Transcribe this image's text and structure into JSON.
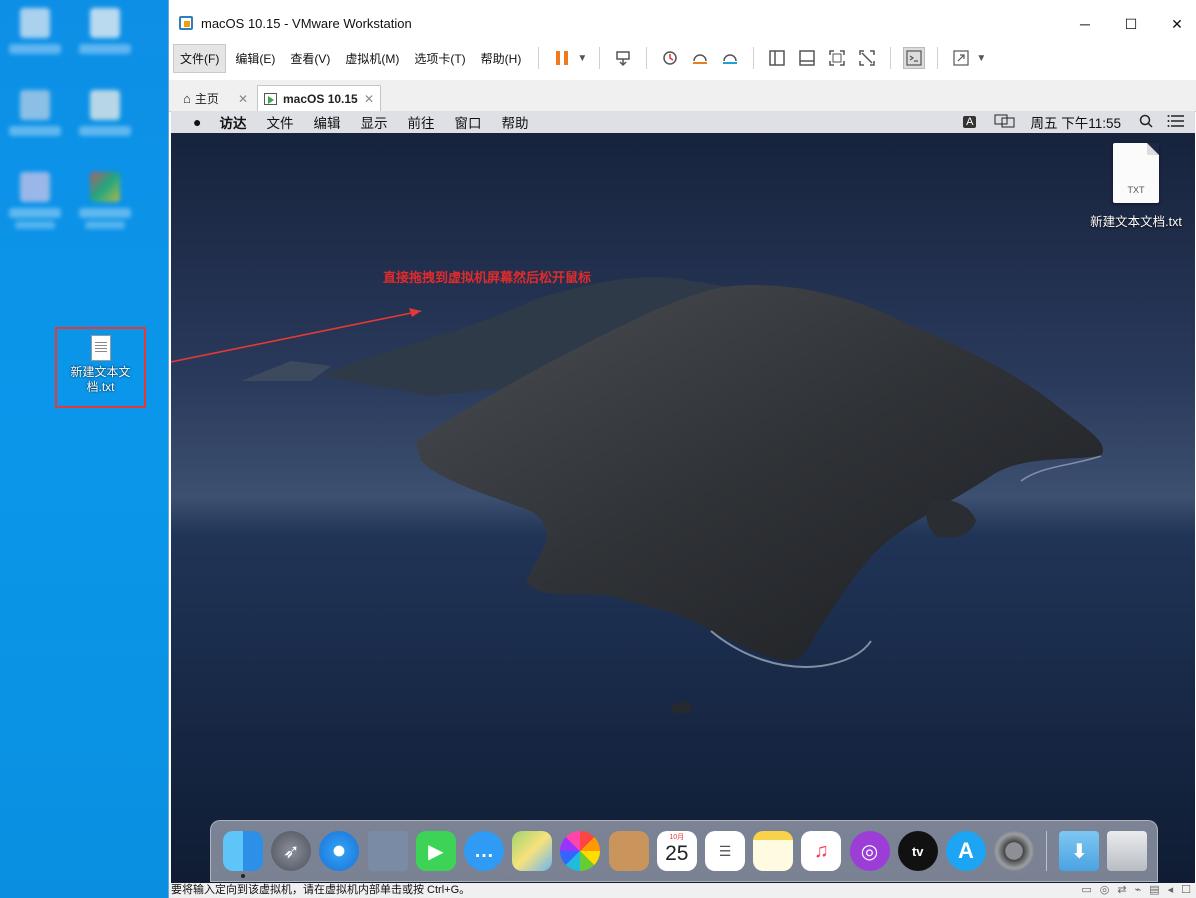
{
  "desktop": {
    "file": {
      "name": "新建文本文档.txt"
    }
  },
  "window": {
    "title": "macOS 10.15 - VMware Workstation",
    "minimize": "─",
    "maximize": "☐",
    "close": "✕"
  },
  "menu": [
    "文件(F)",
    "编辑(E)",
    "查看(V)",
    "虚拟机(M)",
    "选项卡(T)",
    "帮助(H)"
  ],
  "tabs": [
    {
      "label": "主页",
      "close": "✕"
    },
    {
      "label": "macOS 10.15",
      "close": "✕"
    }
  ],
  "mac": {
    "menubar": [
      "访达",
      "文件",
      "编辑",
      "显示",
      "前往",
      "窗口",
      "帮助"
    ],
    "input_indicator": "A",
    "clock": "周五 下午11:55",
    "desktop_file": {
      "name": "新建文本文档.txt",
      "badge": "TXT"
    },
    "annotation": "直接拖拽到虚拟机屏幕然后松开鼠标",
    "calendar": {
      "month": "10月",
      "day": "25"
    },
    "tv_label": "tv"
  },
  "statusbar": {
    "text": "要将输入定向到该虚拟机，请在虚拟机内部单击或按 Ctrl+G。"
  },
  "colors": {
    "annotation": "#e02b2b",
    "desktop_blue": "#0a8fe0",
    "highlight_border": "#e53935"
  }
}
